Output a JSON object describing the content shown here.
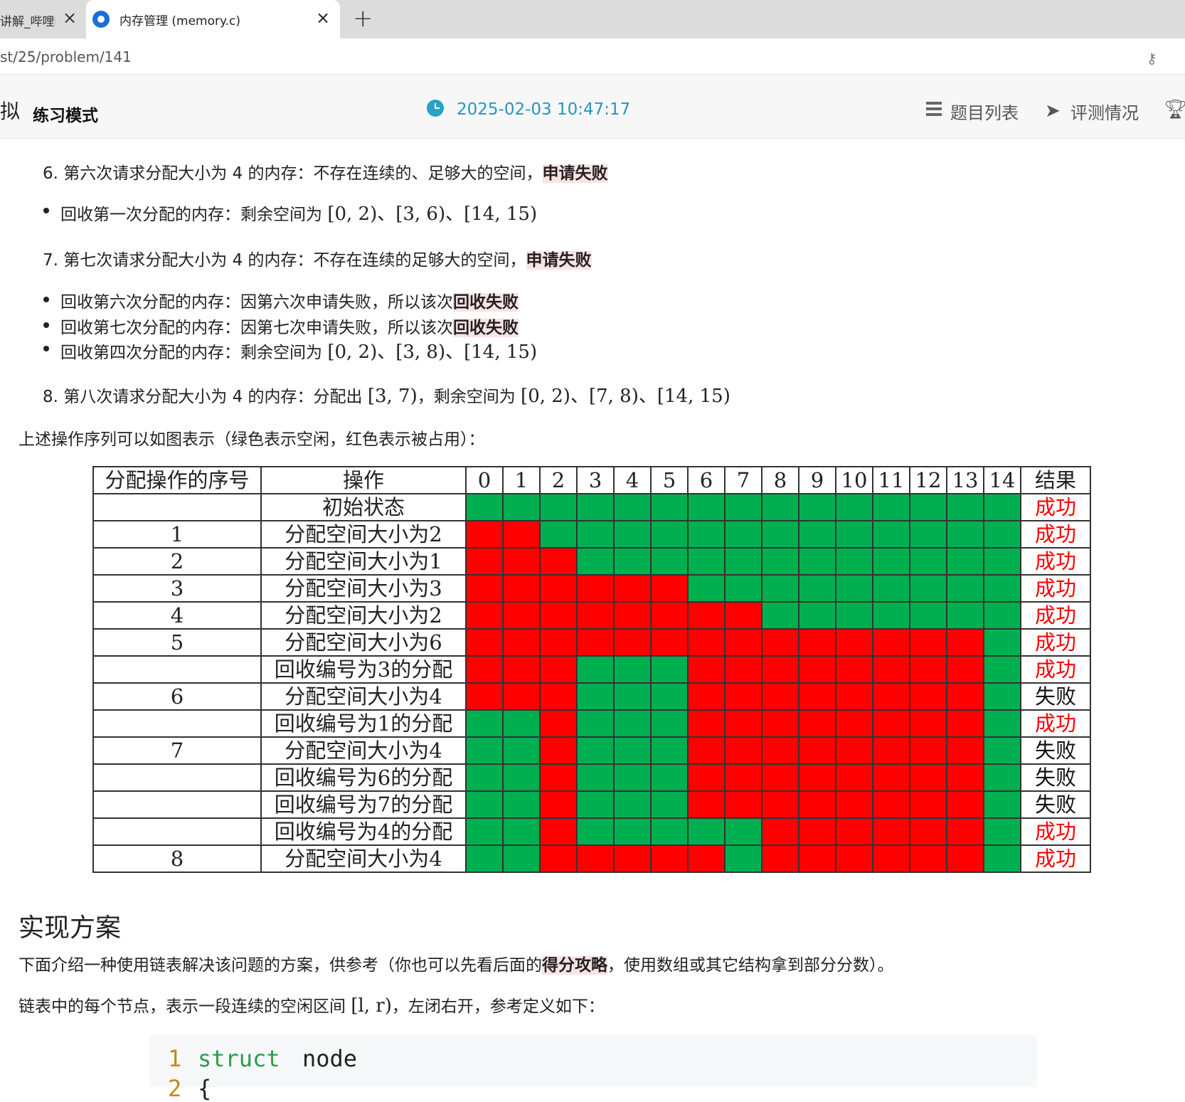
{
  "tabs": [
    {
      "label": "讲解_哔哩哔"
    },
    {
      "label": "内存管理 (memory.c)"
    }
  ],
  "url": "st/25/problem/141",
  "header": {
    "mode_prefix": "拟",
    "mode": "练习模式",
    "time": "2025-02-03 10:47:17",
    "nav": {
      "problems": "题目列表",
      "status": "评测情况"
    }
  },
  "steps": {
    "s6": {
      "text": "6. 第六次请求分配大小为 4 的内存：不存在连续的、足够大的空间，",
      "em": "申请失败"
    },
    "b1": {
      "text": "回收第一次分配的内存：剩余空间为 ",
      "math": "[0, 2)、[3, 6)、[14, 15)"
    },
    "s7": {
      "text": "7. 第七次请求分配大小为 4 的内存：不存在连续的足够大的空间，",
      "em": "申请失败"
    },
    "b2": {
      "text": "回收第六次分配的内存：因第六次申请失败，所以该次",
      "em": "回收失败"
    },
    "b3": {
      "text": "回收第七次分配的内存：因第七次申请失败，所以该次",
      "em": "回收失败"
    },
    "b4": {
      "text": "回收第四次分配的内存：剩余空间为 ",
      "math": "[0, 2)、[3, 8)、[14, 15)"
    },
    "s8": {
      "text": "8. 第八次请求分配大小为 4 的内存：分配出 ",
      "math1": "[3, 7)",
      "mid": "，剩余空间为 ",
      "math2": "[0, 2)、[7, 8)、[14, 15)"
    }
  },
  "fig_caption": "上述操作序列可以如图表示（绿色表示空闲，红色表示被占用）：",
  "figure": {
    "headers": [
      "分配操作的序号",
      "操作",
      "0",
      "1",
      "2",
      "3",
      "4",
      "5",
      "6",
      "7",
      "8",
      "9",
      "10",
      "11",
      "12",
      "13",
      "14",
      "结果"
    ],
    "rows": [
      {
        "seq": "",
        "op": "初始状态",
        "cells": "GGGGGGGGGGGGGGG",
        "result": "成功",
        "ok": true
      },
      {
        "seq": "1",
        "op": "分配空间大小为2",
        "cells": "RRGGGGGGGGGGGGG",
        "result": "成功",
        "ok": true
      },
      {
        "seq": "2",
        "op": "分配空间大小为1",
        "cells": "RRRGGGGGGGGGGGG",
        "result": "成功",
        "ok": true
      },
      {
        "seq": "3",
        "op": "分配空间大小为3",
        "cells": "RRRRRRGGGGGGGGG",
        "result": "成功",
        "ok": true
      },
      {
        "seq": "4",
        "op": "分配空间大小为2",
        "cells": "RRRRRRRRGGGGGGG",
        "result": "成功",
        "ok": true
      },
      {
        "seq": "5",
        "op": "分配空间大小为6",
        "cells": "RRRRRRRRRRRRRRG",
        "result": "成功",
        "ok": true
      },
      {
        "seq": "",
        "op": "回收编号为3的分配",
        "cells": "RRRGGGRRRRRRRRG",
        "result": "成功",
        "ok": true
      },
      {
        "seq": "6",
        "op": "分配空间大小为4",
        "cells": "RRRGGGRRRRRRRRG",
        "result": "失败",
        "ok": false
      },
      {
        "seq": "",
        "op": "回收编号为1的分配",
        "cells": "GGRGGGRRRRRRRRG",
        "result": "成功",
        "ok": true
      },
      {
        "seq": "7",
        "op": "分配空间大小为4",
        "cells": "GGRGGGRRRRRRRRG",
        "result": "失败",
        "ok": false
      },
      {
        "seq": "",
        "op": "回收编号为6的分配",
        "cells": "GGRGGGRRRRRRRRG",
        "result": "失败",
        "ok": false
      },
      {
        "seq": "",
        "op": "回收编号为7的分配",
        "cells": "GGRGGGRRRRRRRRG",
        "result": "失败",
        "ok": false
      },
      {
        "seq": "",
        "op": "回收编号为4的分配",
        "cells": "GGRGGGGGRRRRRRG",
        "result": "成功",
        "ok": true
      },
      {
        "seq": "8",
        "op": "分配空间大小为4",
        "cells": "GGRRRRRGRRRRRRG",
        "result": "成功",
        "ok": true
      }
    ]
  },
  "section": {
    "title": "实现方案",
    "p1_a": "下面介绍一种使用链表解决该问题的方案，供参考（你也可以先看后面的",
    "p1_em": "得分攻略",
    "p1_b": "，使用数组或其它结构拿到部分分数）。",
    "p2_a": "链表中的每个节点，表示一段连续的空闲区间 ",
    "p2_math": "[l, r)",
    "p2_b": "，左闭右开，参考定义如下："
  },
  "code": {
    "line1_no": "1",
    "kw": "struct",
    "id": "node",
    "line2_no": "2",
    "brace": "{"
  },
  "colors": {
    "free": "#00b050",
    "used": "#ff0000",
    "accent": "#2597c1"
  }
}
